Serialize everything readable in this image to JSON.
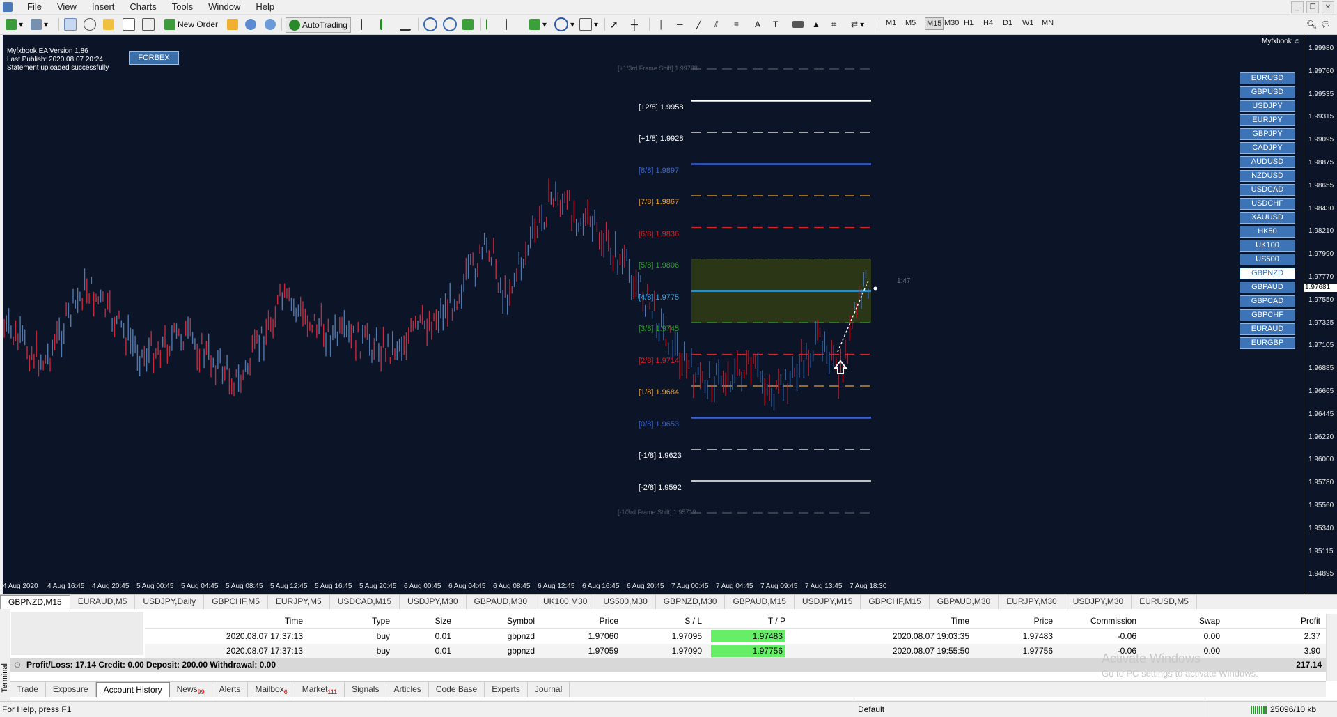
{
  "menu": [
    "File",
    "View",
    "Insert",
    "Charts",
    "Tools",
    "Window",
    "Help"
  ],
  "toolbar": {
    "new_order": "New Order",
    "autotrading": "AutoTrading",
    "timeframes": [
      "M1",
      "M5",
      "M15",
      "M30",
      "H1",
      "H4",
      "D1",
      "W1",
      "MN"
    ],
    "active_tf": "M15"
  },
  "chart": {
    "ea_info": [
      "Myfxbook EA Version 1.86",
      "Last Publish: 2020.08.07 20:24",
      "Statement uploaded successfully"
    ],
    "forbex_label": "FORBEX",
    "myfxbook_label": "Myfxbook ☺",
    "time_label": "1:47",
    "current_price": "1.97681",
    "symbols": [
      "EURUSD",
      "GBPUSD",
      "USDJPY",
      "EURJPY",
      "GBPJPY",
      "CADJPY",
      "AUDUSD",
      "NZDUSD",
      "USDCAD",
      "USDCHF",
      "XAUUSD",
      "HK50",
      "UK100",
      "US500",
      "GBPNZD",
      "GBPAUD",
      "GBPCAD",
      "GBPCHF",
      "EURAUD",
      "EURGBP"
    ],
    "selected_symbol": "GBPNZD",
    "price_ticks": [
      "1.99980",
      "1.99760",
      "1.99535",
      "1.99315",
      "1.99095",
      "1.98875",
      "1.98655",
      "1.98430",
      "1.98210",
      "1.97990",
      "1.97770",
      "1.97550",
      "1.97325",
      "1.97105",
      "1.96885",
      "1.96665",
      "1.96445",
      "1.96220",
      "1.96000",
      "1.95780",
      "1.95560",
      "1.95340",
      "1.95115",
      "1.94895"
    ],
    "time_ticks": [
      "4 Aug 2020",
      "4 Aug 16:45",
      "4 Aug 20:45",
      "5 Aug 00:45",
      "5 Aug 04:45",
      "5 Aug 08:45",
      "5 Aug 12:45",
      "5 Aug 16:45",
      "5 Aug 20:45",
      "6 Aug 00:45",
      "6 Aug 04:45",
      "6 Aug 08:45",
      "6 Aug 12:45",
      "6 Aug 16:45",
      "6 Aug 20:45",
      "7 Aug 00:45",
      "7 Aug 04:45",
      "7 Aug 09:45",
      "7 Aug 13:45",
      "7 Aug 18:30"
    ],
    "murrey_levels": [
      {
        "label": "[+1/3rd Frame Shift]  1.99788",
        "color": "#555a66",
        "line": "dash"
      },
      {
        "label": "[+2/8]  1.9958",
        "color": "#ffffff",
        "line": "solid"
      },
      {
        "label": "[+1/8]  1.9928",
        "color": "#ffffff",
        "line": "dash"
      },
      {
        "label": "[8/8]  1.9897",
        "color": "#3a63d9",
        "line": "solid"
      },
      {
        "label": "[7/8]  1.9867",
        "color": "#f0a02a",
        "line": "dash"
      },
      {
        "label": "[6/8]  1.9836",
        "color": "#d4232a",
        "line": "dash"
      },
      {
        "label": "[5/8]  1.9806",
        "color": "#2fa02f",
        "line": "dash"
      },
      {
        "label": "[4/8]  1.9775",
        "color": "#33aaf0",
        "line": "solid"
      },
      {
        "label": "[3/8]  1.9745",
        "color": "#2fa02f",
        "line": "dash"
      },
      {
        "label": "[2/8]  1.9714",
        "color": "#d4232a",
        "line": "dash"
      },
      {
        "label": "[1/8]  1.9684",
        "color": "#f0a02a",
        "line": "dash"
      },
      {
        "label": "[0/8]  1.9653",
        "color": "#3a63d9",
        "line": "solid"
      },
      {
        "label": "[-1/8]  1.9623",
        "color": "#ffffff",
        "line": "dash"
      },
      {
        "label": "[-2/8]  1.9592",
        "color": "#ffffff",
        "line": "solid"
      },
      {
        "label": "[-1/3rd Frame Shift]  1.95719",
        "color": "#555a66",
        "line": "dash"
      }
    ]
  },
  "chart_tabs": [
    "GBPNZD,M15",
    "EURAUD,M5",
    "USDJPY,Daily",
    "GBPCHF,M5",
    "EURJPY,M5",
    "USDCAD,M15",
    "USDJPY,M30",
    "GBPAUD,M30",
    "UK100,M30",
    "US500,M30",
    "GBPNZD,M30",
    "GBPAUD,M15",
    "USDJPY,M15",
    "GBPCHF,M15",
    "GBPAUD,M30",
    "EURJPY,M30",
    "USDJPY,M30",
    "EURUSD,M5"
  ],
  "terminal": {
    "side_label": "Terminal",
    "columns": [
      "Time",
      "Type",
      "Size",
      "Symbol",
      "Price",
      "S / L",
      "T / P",
      "Time",
      "Price",
      "Commission",
      "Swap",
      "Profit"
    ],
    "rows": [
      [
        "2020.08.07 17:37:13",
        "buy",
        "0.01",
        "gbpnzd",
        "1.97060",
        "1.97095",
        "1.97483",
        "2020.08.07 19:03:35",
        "1.97483",
        "-0.06",
        "0.00",
        "2.37"
      ],
      [
        "2020.08.07 17:37:13",
        "buy",
        "0.01",
        "gbpnzd",
        "1.97059",
        "1.97090",
        "1.97756",
        "2020.08.07 19:55:50",
        "1.97756",
        "-0.06",
        "0.00",
        "3.90"
      ]
    ],
    "summary": "Profit/Loss: 17.14  Credit: 0.00  Deposit: 200.00  Withdrawal: 0.00",
    "summary_total": "217.14",
    "tabs": [
      {
        "label": "Trade",
        "badge": ""
      },
      {
        "label": "Exposure",
        "badge": ""
      },
      {
        "label": "Account History",
        "badge": ""
      },
      {
        "label": "News",
        "badge": "99"
      },
      {
        "label": "Alerts",
        "badge": ""
      },
      {
        "label": "Mailbox",
        "badge": "6"
      },
      {
        "label": "Market",
        "badge": "111"
      },
      {
        "label": "Signals",
        "badge": ""
      },
      {
        "label": "Articles",
        "badge": ""
      },
      {
        "label": "Code Base",
        "badge": ""
      },
      {
        "label": "Experts",
        "badge": ""
      },
      {
        "label": "Journal",
        "badge": ""
      }
    ],
    "active_tab": "Account History",
    "watermark_title": "Activate Windows",
    "watermark_sub": "Go to PC settings to activate Windows."
  },
  "status": {
    "help": "For Help, press F1",
    "profile": "Default",
    "traffic": "25096/10 kb"
  }
}
